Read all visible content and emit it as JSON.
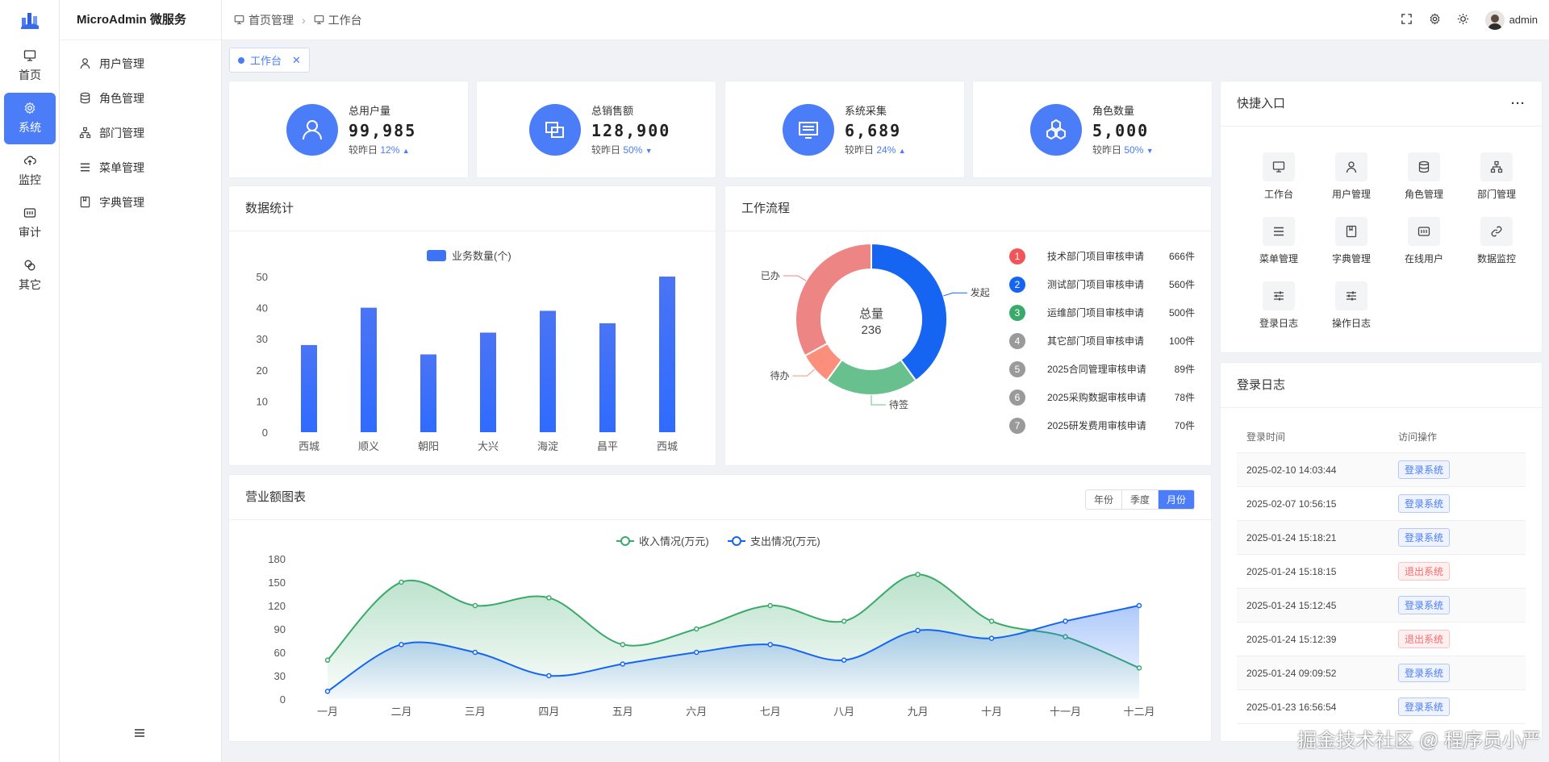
{
  "rail": {
    "items": [
      {
        "label": "首页",
        "icon": "monitor-icon"
      },
      {
        "label": "系统",
        "icon": "gear-icon"
      },
      {
        "label": "监控",
        "icon": "cloud-upload-icon"
      },
      {
        "label": "审计",
        "icon": "audit-icon"
      },
      {
        "label": "其它",
        "icon": "link-icon"
      }
    ]
  },
  "sidebar": {
    "title": "MicroAdmin 微服务",
    "items": [
      {
        "label": "用户管理",
        "icon": "user-icon"
      },
      {
        "label": "角色管理",
        "icon": "database-icon"
      },
      {
        "label": "部门管理",
        "icon": "org-icon"
      },
      {
        "label": "菜单管理",
        "icon": "list-icon"
      },
      {
        "label": "字典管理",
        "icon": "book-icon"
      }
    ]
  },
  "header": {
    "breadcrumb": [
      "首页管理",
      "工作台"
    ],
    "username": "admin"
  },
  "tabs": [
    {
      "label": "工作台"
    }
  ],
  "stats": [
    {
      "label": "总用户量",
      "value": "99,985",
      "compare": "较昨日",
      "percent": "12%",
      "trend": "up",
      "icon": "user-icon"
    },
    {
      "label": "总销售额",
      "value": "128,900",
      "compare": "较昨日",
      "percent": "50%",
      "trend": "down",
      "icon": "layers-icon"
    },
    {
      "label": "系统采集",
      "value": "6,689",
      "compare": "较昨日",
      "percent": "24%",
      "trend": "up",
      "icon": "screen-icon"
    },
    {
      "label": "角色数量",
      "value": "5,000",
      "compare": "较昨日",
      "percent": "50%",
      "trend": "down",
      "icon": "hexagons-icon"
    }
  ],
  "data_stats": {
    "title": "数据统计"
  },
  "workflow": {
    "title": "工作流程",
    "total_label": "总量",
    "total_value": "236",
    "items": [
      {
        "num": "1",
        "name": "技术部门项目审核申请",
        "count": "666件",
        "color": "#f0555a"
      },
      {
        "num": "2",
        "name": "测试部门项目审核申请",
        "count": "560件",
        "color": "#1565f2"
      },
      {
        "num": "3",
        "name": "运维部门项目审核申请",
        "count": "500件",
        "color": "#3aaa6a"
      },
      {
        "num": "4",
        "name": "其它部门项目审核申请",
        "count": "100件",
        "color": "#9a9a9a"
      },
      {
        "num": "5",
        "name": "2025合同管理审核申请",
        "count": "89件",
        "color": "#9a9a9a"
      },
      {
        "num": "6",
        "name": "2025采购数据审核申请",
        "count": "78件",
        "color": "#9a9a9a"
      },
      {
        "num": "7",
        "name": "2025研发费用审核申请",
        "count": "70件",
        "color": "#9a9a9a"
      }
    ]
  },
  "revenue": {
    "title": "营业额图表",
    "periods": [
      "年份",
      "季度",
      "月份"
    ],
    "active_period": "月份"
  },
  "quick": {
    "title": "快捷入口",
    "more": "···",
    "items": [
      {
        "label": "工作台",
        "icon": "monitor-icon"
      },
      {
        "label": "用户管理",
        "icon": "user-icon"
      },
      {
        "label": "角色管理",
        "icon": "database-icon"
      },
      {
        "label": "部门管理",
        "icon": "org-icon"
      },
      {
        "label": "菜单管理",
        "icon": "list-icon"
      },
      {
        "label": "字典管理",
        "icon": "book-icon"
      },
      {
        "label": "在线用户",
        "icon": "online-icon"
      },
      {
        "label": "数据监控",
        "icon": "link-icon"
      },
      {
        "label": "登录日志",
        "icon": "sliders-icon"
      },
      {
        "label": "操作日志",
        "icon": "sliders-icon"
      }
    ]
  },
  "login_log": {
    "title": "登录日志",
    "columns": [
      "登录时间",
      "访问操作"
    ],
    "rows": [
      {
        "time": "2025-02-10 14:03:44",
        "action": "登录系统",
        "type": "in"
      },
      {
        "time": "2025-02-07 10:56:15",
        "action": "登录系统",
        "type": "in"
      },
      {
        "time": "2025-01-24 15:18:21",
        "action": "登录系统",
        "type": "in"
      },
      {
        "time": "2025-01-24 15:18:15",
        "action": "退出系统",
        "type": "out"
      },
      {
        "time": "2025-01-24 15:12:45",
        "action": "登录系统",
        "type": "in"
      },
      {
        "time": "2025-01-24 15:12:39",
        "action": "退出系统",
        "type": "out"
      },
      {
        "time": "2025-01-24 09:09:52",
        "action": "登录系统",
        "type": "in"
      },
      {
        "time": "2025-01-23 16:56:54",
        "action": "登录系统",
        "type": "in"
      }
    ]
  },
  "watermark": "掘金技术社区 @ 程序员小严",
  "colors": {
    "accent": "#4a7df7",
    "income": "#3aaa6a",
    "expense": "#1565f2"
  },
  "chart_data": [
    {
      "type": "bar",
      "title": "",
      "legend": [
        "业务数量(个)"
      ],
      "categories": [
        "西城",
        "顺义",
        "朝阳",
        "大兴",
        "海淀",
        "昌平",
        "西城"
      ],
      "series": [
        {
          "name": "业务数量(个)",
          "values": [
            28,
            40,
            25,
            32,
            39,
            35,
            50
          ]
        }
      ],
      "ylim": [
        0,
        50
      ],
      "yticks": [
        0,
        10,
        20,
        30,
        40,
        50
      ]
    },
    {
      "type": "pie",
      "title": "",
      "categories": [
        "发起",
        "待签",
        "待办",
        "已办"
      ],
      "values": [
        40,
        20,
        7,
        33
      ],
      "colors": [
        "#1565f2",
        "#67c08d",
        "#fb8f7c",
        "#ee8585"
      ],
      "center_label": "总量",
      "center_value": "236"
    },
    {
      "type": "area",
      "title": "",
      "categories": [
        "一月",
        "二月",
        "三月",
        "四月",
        "五月",
        "六月",
        "七月",
        "八月",
        "九月",
        "十月",
        "十一月",
        "十二月"
      ],
      "series": [
        {
          "name": "收入情况(万元)",
          "values": [
            50,
            150,
            120,
            130,
            70,
            90,
            120,
            100,
            160,
            100,
            80,
            40
          ]
        },
        {
          "name": "支出情况(万元)",
          "values": [
            10,
            70,
            60,
            30,
            45,
            60,
            70,
            50,
            88,
            78,
            100,
            120
          ]
        }
      ],
      "ylim": [
        0,
        180
      ],
      "yticks": [
        0,
        30,
        60,
        90,
        120,
        150,
        180
      ]
    }
  ]
}
